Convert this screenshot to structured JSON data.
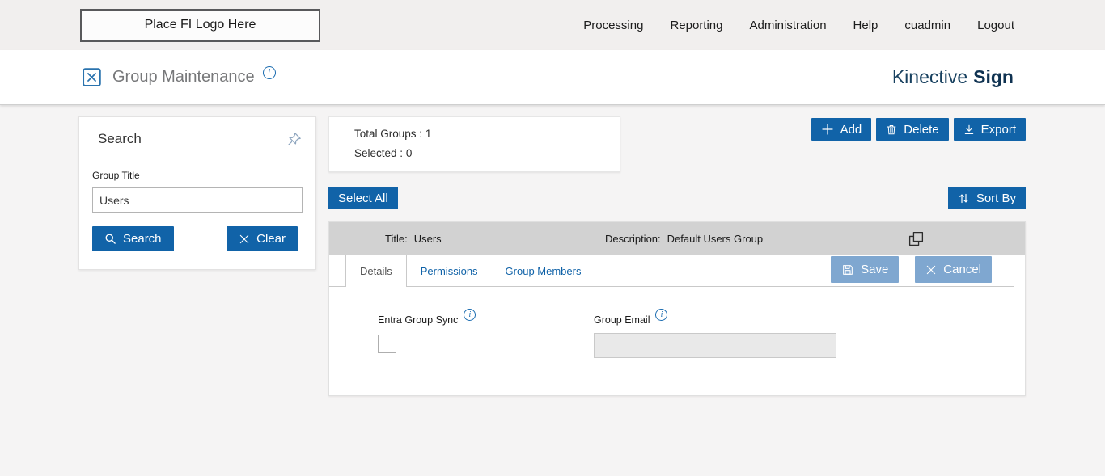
{
  "icons": {
    "info": "i"
  },
  "colors": {
    "primary": "#1163a8",
    "muted_action": "#7fa7d0",
    "brand_navy": "#0f3251",
    "row_gray": "#d2d2d2"
  },
  "topbar": {
    "logo_placeholder": "Place FI Logo Here",
    "nav": [
      {
        "label": "Processing"
      },
      {
        "label": "Reporting"
      },
      {
        "label": "Administration"
      },
      {
        "label": "Help"
      },
      {
        "label": "cuadmin"
      },
      {
        "label": "Logout"
      }
    ]
  },
  "subheader": {
    "title": "Group Maintenance",
    "brand_first": "Kinective",
    "brand_second": "Sign"
  },
  "search": {
    "title": "Search",
    "group_title_label": "Group Title",
    "group_title_value": "Users",
    "search_button": "Search",
    "clear_button": "Clear"
  },
  "summary": {
    "total_groups_label": "Total Groups :",
    "total_groups_value": "1",
    "selected_label": "Selected :",
    "selected_value": "0"
  },
  "toolbar": {
    "add": "Add",
    "delete": "Delete",
    "export": "Export",
    "select_all": "Select All",
    "sort_by": "Sort By"
  },
  "group": {
    "title_label": "Title:",
    "title_value": "Users",
    "description_label": "Description:",
    "description_value": "Default Users Group"
  },
  "detail": {
    "tabs": [
      {
        "label": "Details",
        "active": true
      },
      {
        "label": "Permissions",
        "active": false
      },
      {
        "label": "Group Members",
        "active": false
      }
    ],
    "save": "Save",
    "cancel": "Cancel",
    "entra_group_sync_label": "Entra Group Sync",
    "entra_group_sync_checked": false,
    "group_email_label": "Group Email",
    "group_email_value": ""
  }
}
